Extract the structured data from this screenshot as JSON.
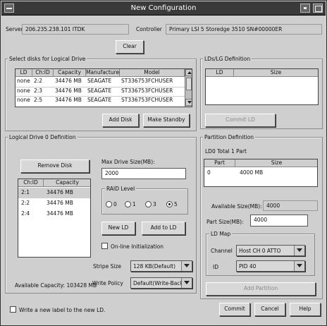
{
  "window": {
    "title": "New Configuration"
  },
  "header": {
    "server_label": "Server",
    "server_value": "206.235.238.101 ITDK",
    "controller_label": "Controller",
    "controller_value": "Primary LSI 5 Storedge 3510 SN#00000ER"
  },
  "buttons": {
    "clear": "Clear",
    "add_disk": "Add Disk",
    "make_standby": "Make Standby",
    "remove_disk": "Remove Disk",
    "new_ld": "New LD",
    "add_to_ld": "Add to LD",
    "commit_ld": "Commit LD",
    "add_partition": "Add Partition",
    "commit": "Commit",
    "cancel": "Cancel",
    "help": "Help"
  },
  "select_disks": {
    "label": "Select disks for Logical Drive",
    "columns": [
      "LD",
      "Ch:ID",
      "Capacity",
      "Manufacturer",
      "Model"
    ],
    "rows": [
      [
        "none",
        "2:2",
        "34476 MB",
        "SEAGATE",
        "ST336753FCHUSER"
      ],
      [
        "none",
        "2:3",
        "34476 MB",
        "SEAGATE",
        "ST336753FCHUSER"
      ],
      [
        "none",
        "2:5",
        "34476 MB",
        "SEAGATE",
        "ST336753FCHUSER"
      ]
    ]
  },
  "ld_definition_top": {
    "label": "LDs/LG Definition",
    "columns": [
      "LD",
      "Size"
    ]
  },
  "logical_drive_def": {
    "label": "Logical Drive 0 Definition",
    "columns": [
      "Ch:ID",
      "Capacity"
    ],
    "rows": [
      [
        "2:1",
        "34476 MB"
      ],
      [
        "2:2",
        "34476 MB"
      ],
      [
        "2:4",
        "34476 MB"
      ]
    ],
    "max_drive_size_label": "Max Drive Size(MB):",
    "max_drive_size_value": "2000",
    "raid_level_label": "RAID Level",
    "raid_options": [
      "0",
      "1",
      "3",
      "5"
    ],
    "raid_selected": "5",
    "online_init_label": "On-line Initialization",
    "stripe_size_label": "Stripe Size",
    "stripe_size_value": "128 KB(Default)",
    "write_policy_label": "Write Policy",
    "write_policy_value": "Default(Write-Back)",
    "available_label": "Available Capacity: 103428 MB"
  },
  "partition_def": {
    "label": "Partition Definition",
    "ld_label": "LD0 Total 1 Part",
    "columns": [
      "Part",
      "Size"
    ],
    "rows": [
      [
        "0",
        "4000 MB"
      ]
    ],
    "available_size_label": "Available Size(MB):",
    "available_size_value": "4000",
    "part_size_label": "Part Size(MB):",
    "part_size_value": "4000",
    "ld_map_label": "LD Map",
    "channel_label": "Channel",
    "channel_value": "Host CH 0 ATTO",
    "id_label": "ID",
    "id_value": "PID 40"
  },
  "footer": {
    "write_label_text": "Write a new label to the new LD."
  }
}
